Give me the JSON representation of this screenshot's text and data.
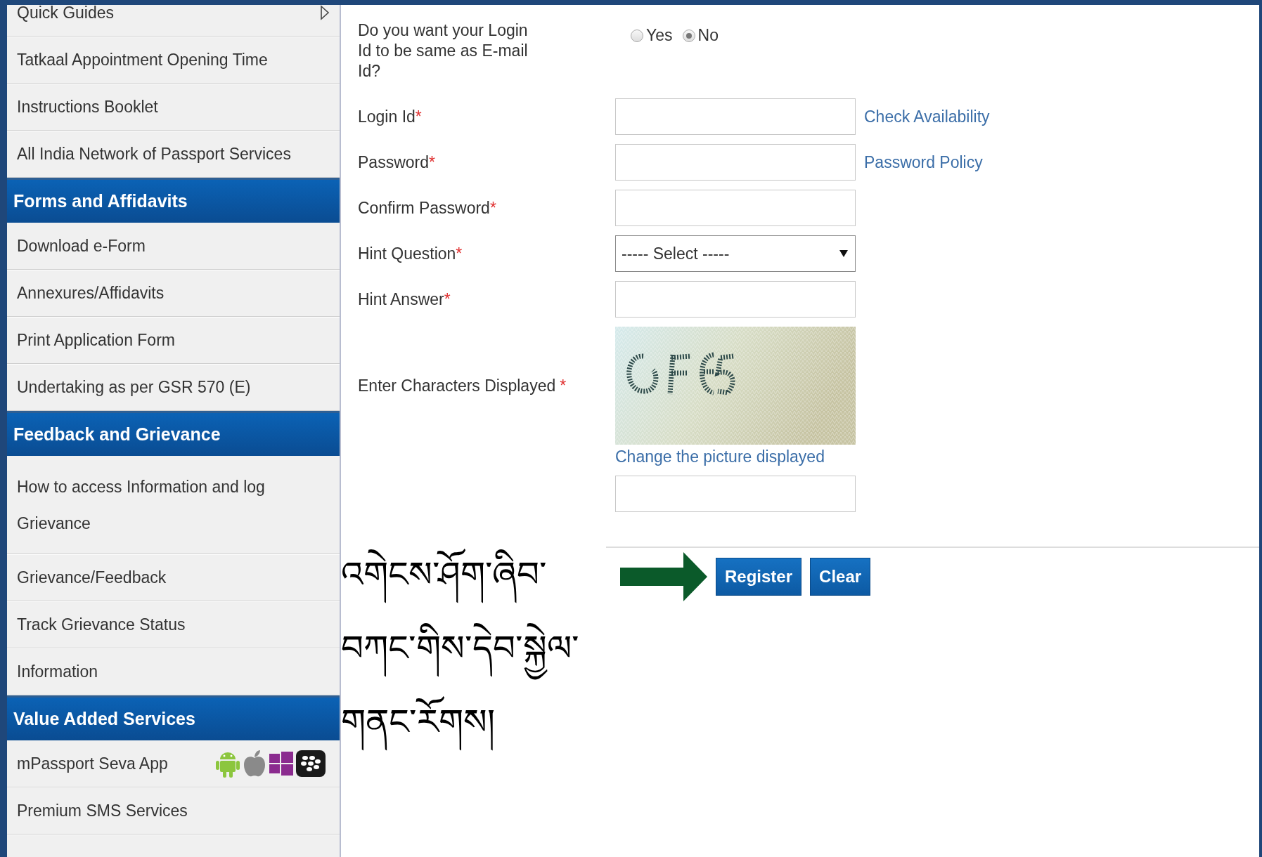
{
  "sidebar": {
    "items": [
      {
        "kind": "submenu",
        "label": "Quick Guides"
      },
      {
        "kind": "item",
        "label": "Tatkaal Appointment Opening Time"
      },
      {
        "kind": "item",
        "label": "Instructions Booklet"
      },
      {
        "kind": "item",
        "label": "All India Network of Passport Services"
      },
      {
        "kind": "header",
        "label": "Forms and Affidavits"
      },
      {
        "kind": "item",
        "label": "Download e-Form"
      },
      {
        "kind": "item",
        "label": "Annexures/Affidavits"
      },
      {
        "kind": "item",
        "label": "Print Application Form"
      },
      {
        "kind": "item",
        "label": "Undertaking as per GSR 570 (E)"
      },
      {
        "kind": "header",
        "label": "Feedback and Grievance"
      },
      {
        "kind": "item",
        "label": "How to access Information and log Grievance"
      },
      {
        "kind": "item",
        "label": "Grievance/Feedback"
      },
      {
        "kind": "item",
        "label": "Track Grievance Status"
      },
      {
        "kind": "item",
        "label": "Information"
      },
      {
        "kind": "header",
        "label": "Value Added Services"
      },
      {
        "kind": "apps",
        "label": "mPassport Seva App"
      },
      {
        "kind": "item",
        "label": "Premium SMS Services"
      }
    ]
  },
  "form": {
    "question": {
      "text": "Do you want your Login Id to be same as E-mail Id?",
      "options": [
        {
          "label": "Yes",
          "selected": false
        },
        {
          "label": "No",
          "selected": true
        }
      ]
    },
    "fields": [
      {
        "kind": "text",
        "label": "Login Id",
        "required_mark": "*",
        "link": "Check Availability"
      },
      {
        "kind": "password",
        "label": "Password",
        "required_mark": "*",
        "link": "Password Policy"
      },
      {
        "kind": "password",
        "label": "Confirm Password",
        "required_mark": "*"
      },
      {
        "kind": "select",
        "label": "Hint Question",
        "required_mark": "*",
        "value": "----- Select -----"
      },
      {
        "kind": "text",
        "label": "Hint Answer",
        "required_mark": "*"
      },
      {
        "kind": "captcha",
        "label": "Enter Characters Displayed",
        "required_mark": "*",
        "link": "Change the picture displayed"
      }
    ],
    "buttons": [
      {
        "label": "Register"
      },
      {
        "label": "Clear"
      }
    ]
  },
  "notice": {
    "lines": [
      "འགེངས་ཤོག་ཞིབ་",
      "བཀང་གིས་དེབ་སྐྱེལ་",
      "གནང་རོགས།"
    ]
  }
}
